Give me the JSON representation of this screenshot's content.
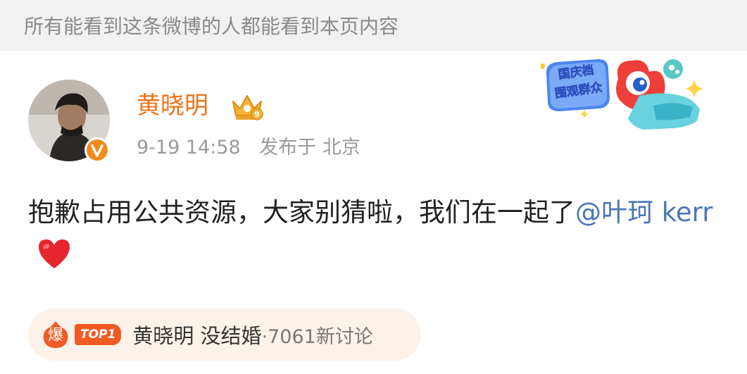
{
  "visibility_notice": "所有能看到这条微博的人都能看到本页内容",
  "author": {
    "name": "黄晓明",
    "verified": true
  },
  "post": {
    "date": "9-19 14:58",
    "location": "发布于 北京",
    "text": "抱歉占用公共资源，大家别猜啦，我们在一起了",
    "mention": "@叶珂 kerr",
    "emoji": "heart-emoji"
  },
  "event_sticker": {
    "line1": "国庆档",
    "line2": "围观群众"
  },
  "hot_topic": {
    "hot_badge": "爆",
    "rank_badge": "TOP1",
    "title": "黄晓明 没结婚",
    "count": "·7061新讨论"
  },
  "colors": {
    "username": "#eb7319",
    "mention": "#4a77b5",
    "hot_badge": "#f05a24",
    "topic_bg": "#fcf2ea",
    "notice_bg": "#f1f1f1"
  }
}
